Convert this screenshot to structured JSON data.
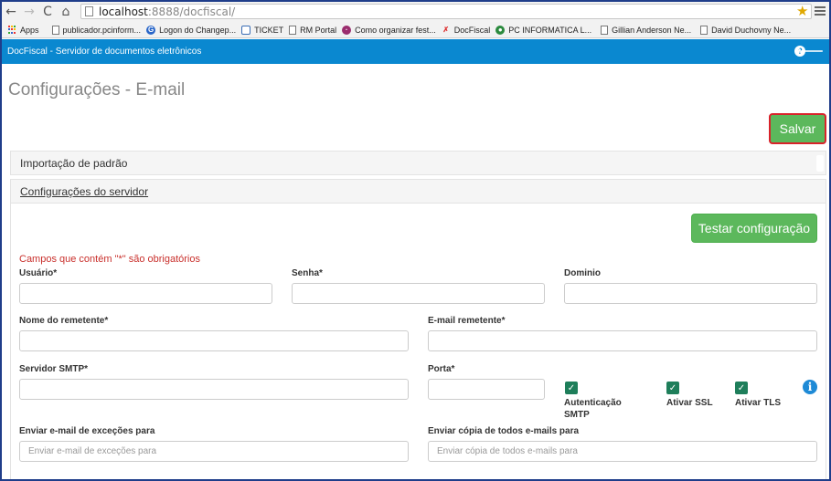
{
  "browser": {
    "url_host": "localhost",
    "url_rest": ":8888/docfiscal/",
    "bookmarks": [
      {
        "label": "Apps",
        "icon": "apps-icon"
      },
      {
        "label": "publicador.pcinform...",
        "icon": "document-icon"
      },
      {
        "label": "Logon do Changep...",
        "icon": "globe-icon"
      },
      {
        "label": "TICKET",
        "icon": "calendar-icon"
      },
      {
        "label": "RM Portal",
        "icon": "document-icon"
      },
      {
        "label": "Como organizar fest...",
        "icon": "site-icon"
      },
      {
        "label": "DocFiscal",
        "icon": "docfiscal-icon"
      },
      {
        "label": "PC INFORMATICA L...",
        "icon": "chrome-icon"
      },
      {
        "label": "Gillian Anderson Ne...",
        "icon": "document-icon"
      },
      {
        "label": "David Duchovny Ne...",
        "icon": "document-icon"
      }
    ]
  },
  "header": {
    "app_title": "DocFiscal - Servidor de documentos eletrônicos",
    "help_icon": "?",
    "back_icon": "arrow-left-icon"
  },
  "page": {
    "title": "Configurações - E-mail",
    "save_label": "Salvar"
  },
  "panels": {
    "import_label": "Importação de padrão",
    "server_label": "Configurações do servidor"
  },
  "form": {
    "test_label": "Testar configuração",
    "required_note": "Campos que contém \"*\" são obrigatórios",
    "usuario_label": "Usuário*",
    "usuario_value": "    ",
    "senha_label": "Senha*",
    "dominio_label": "Dominio",
    "nome_label": "Nome do remetente*",
    "nome_value": "",
    "email_label": "E-mail remetente*",
    "email_value": "",
    "smtp_label": "Servidor SMTP*",
    "smtp_value": "",
    "porta_label": "Porta*",
    "auth_label": "Autenticação SMTP",
    "ssl_label": "Ativar SSL",
    "tls_label": "Ativar TLS",
    "excecoes_label": "Enviar e-mail de exceções para",
    "excecoes_placeholder": "Enviar e-mail de exceções para",
    "copia_label": "Enviar cópia de todos e-mails para",
    "copia_placeholder": "Enviar cópia de todos e-mails para"
  },
  "colors": {
    "header_blue": "#0a88d0",
    "button_green": "#5cb85c",
    "checkbox_green": "#1e7e5a",
    "required_red": "#c9302c"
  }
}
